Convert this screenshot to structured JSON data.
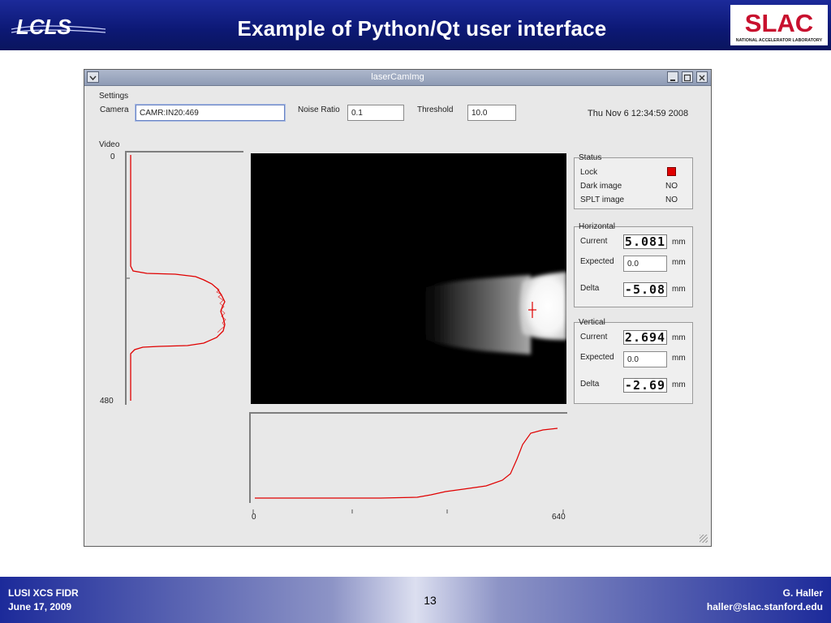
{
  "slide": {
    "title": "Example of Python/Qt user interface",
    "logo_left_text": "LCLS",
    "logo_right_text": "SLAC",
    "logo_right_subtext": "NATIONAL ACCELERATOR LABORATORY",
    "footer": {
      "left_line1": "LUSI  XCS FIDR",
      "left_line2": "June 17, 2009",
      "page_number": "13",
      "right_line1": "G. Haller",
      "right_line2": "haller@slac.stanford.edu"
    }
  },
  "window": {
    "title": "laserCamImg",
    "settings": {
      "group_title": "Settings",
      "camera_label": "Camera",
      "camera_value": "CAMR:IN20:469",
      "noise_label": "Noise Ratio",
      "noise_value": "0.1",
      "threshold_label": "Threshold",
      "threshold_value": "10.0",
      "datetime": "Thu Nov  6 12:34:59 2008"
    },
    "video": {
      "group_title": "Video",
      "vertical_axis": {
        "top_label": "0",
        "bottom_label": "480"
      },
      "horizontal_axis": {
        "left_label": "0",
        "right_label": "640"
      },
      "crosshair_color": "#e00000",
      "profile_color": "#e00000"
    },
    "status": {
      "group_title": "Status",
      "lock_label": "Lock",
      "lock_color": "#e00000",
      "dark_image_label": "Dark image",
      "dark_image_value": "NO",
      "splt_image_label": "SPLT image",
      "splt_image_value": "NO"
    },
    "horizontal": {
      "group_title": "Horizontal",
      "current_label": "Current",
      "current_value": "5.081",
      "current_unit": "mm",
      "expected_label": "Expected",
      "expected_value": "0.0",
      "expected_unit": "mm",
      "delta_label": "Delta",
      "delta_value": "-5.08",
      "delta_unit": "mm"
    },
    "vertical": {
      "group_title": "Vertical",
      "current_label": "Current",
      "current_value": "2.694",
      "current_unit": "mm",
      "expected_label": "Expected",
      "expected_value": "0.0",
      "expected_unit": "mm",
      "delta_label": "Delta",
      "delta_value": "-2.69",
      "delta_unit": "mm"
    }
  }
}
